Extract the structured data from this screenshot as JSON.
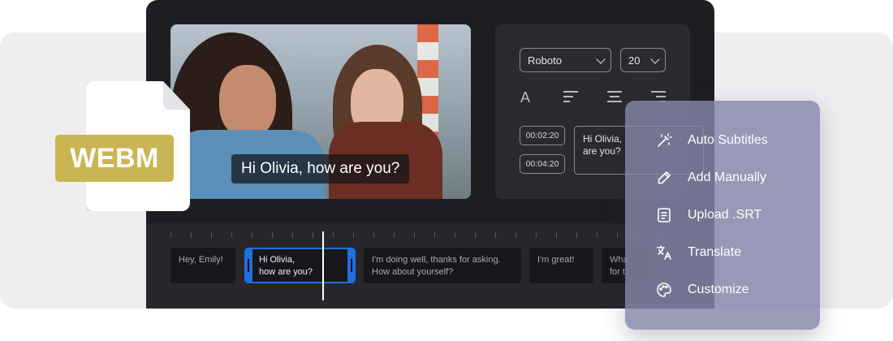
{
  "file_badge": {
    "label": "WEBM"
  },
  "video": {
    "caption": "Hi Olivia, how are you?"
  },
  "panel": {
    "font_select": "Roboto",
    "size_select": "20",
    "format_letter": "A",
    "times": [
      "00:02:20",
      "00:04:20"
    ],
    "subtitle_text_line1": "Hi Olivia,",
    "subtitle_text_line2": "are you?"
  },
  "timeline": {
    "clips": [
      {
        "line1": "Hey, Emily!",
        "line2": ""
      },
      {
        "line1": "Hi Olivia,",
        "line2": "how are you?"
      },
      {
        "line1": "I'm doing well, thanks for asking.",
        "line2": "How about yourself?"
      },
      {
        "line1": "I'm great!",
        "line2": ""
      },
      {
        "line1": "Wha",
        "line2": "for t"
      }
    ]
  },
  "menu": {
    "items": [
      {
        "label": "Auto Subtitles",
        "icon": "magic-wand-icon"
      },
      {
        "label": "Add Manually",
        "icon": "pencil-icon"
      },
      {
        "label": "Upload .SRT",
        "icon": "document-icon"
      },
      {
        "label": "Translate",
        "icon": "translate-icon"
      },
      {
        "label": "Customize",
        "icon": "palette-icon"
      }
    ]
  },
  "colors": {
    "accent_blue": "#1f6fe0",
    "badge_gold": "#c9b553",
    "editor_bg": "#1e1e22",
    "menu_bg": "#8486a8"
  }
}
